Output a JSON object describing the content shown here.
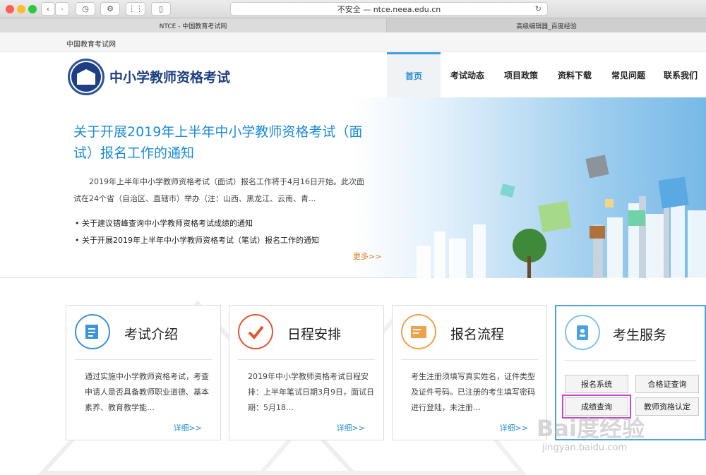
{
  "browser": {
    "address": "不安全 — ntce.neea.edu.cn",
    "tabs": [
      "NTCE - 中国教育考试网",
      "高级编辑器_百度经验"
    ]
  },
  "topbar": {
    "site": "中国教育考试网"
  },
  "header": {
    "title": "中小学教师资格考试",
    "nav": [
      "首页",
      "考试动态",
      "项目政策",
      "资料下载",
      "常见问题",
      "联系我们"
    ]
  },
  "banner": {
    "title": "关于开展2019年上半年中小学教师资格考试（面试）报名工作的通知",
    "summary": "2019年上半年中小学教师资格考试（面试）报名工作将于4月16日开始。此次面试在24个省（自治区、直辖市）举办（注：山西、黑龙江、云南、青...",
    "links": [
      "关于建议错峰查询中小学教师资格考试成绩的通知",
      "关于开展2019年上半年中小学教师资格考试（笔试）报名工作的通知"
    ],
    "more": "更多>>"
  },
  "cards": [
    {
      "title": "考试介绍",
      "text": "通过实施中小学教师资格考试，考查申请人是否具备教师职业道德、基本素养、教育教学能…",
      "more": "详细>>",
      "color": "#3b93d8"
    },
    {
      "title": "日程安排",
      "text": "2019年中小学教师资格考试日程安排：上半年笔试日期3月9日，面试日期：5月18…",
      "more": "详细>>",
      "color": "#e4552e"
    },
    {
      "title": "报名流程",
      "text": "考生注册须填写真实姓名，证件类型及证件号码。已注册的考生填写密码进行登陆，未注册…",
      "more": "详细>>",
      "color": "#f0a24a"
    }
  ],
  "service": {
    "title": "考生服务",
    "buttons": [
      "报名系统",
      "合格证查询",
      "成绩查询",
      "教师资格认定"
    ]
  },
  "watermark": {
    "main": "Bai度经验",
    "sub": "jingyan.baidu.com"
  }
}
